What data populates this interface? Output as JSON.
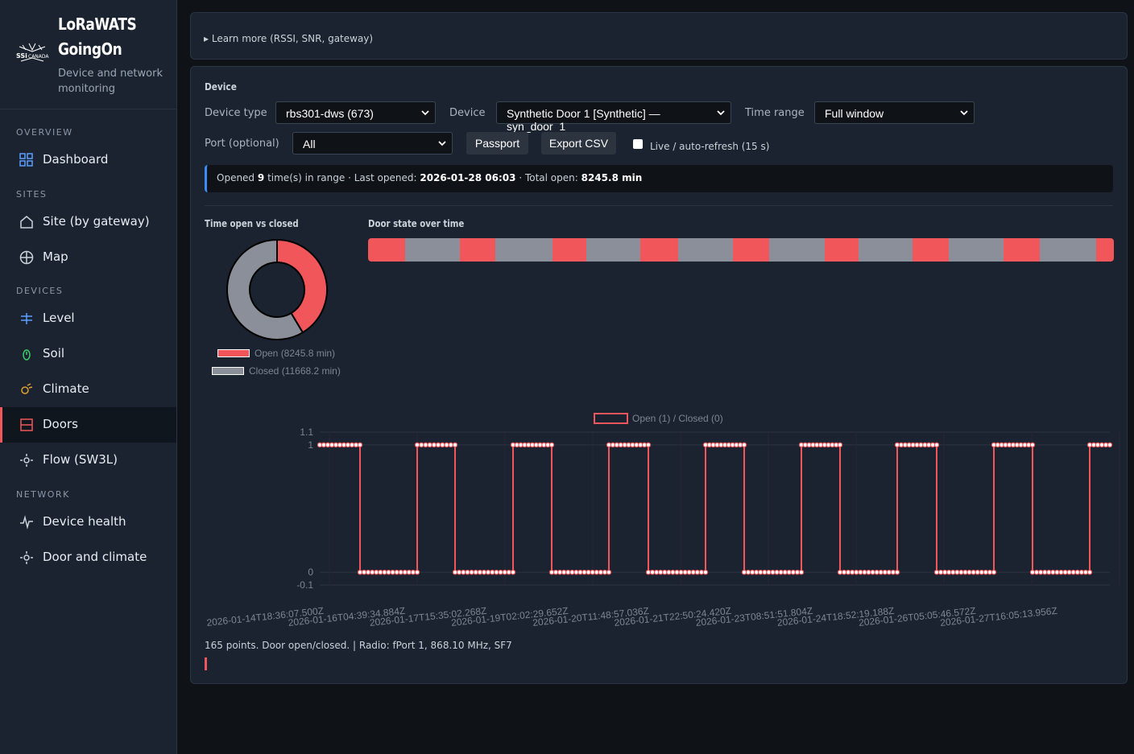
{
  "brand": {
    "title_line1": "LoRaWATS",
    "title_line2": "GoingOn",
    "subtitle": "Device and network monitoring",
    "logo_icon": "ssi-canada-logo"
  },
  "sidebar": {
    "sections": [
      {
        "label": "OVERVIEW"
      },
      {
        "label": "SITES"
      },
      {
        "label": "DEVICES"
      },
      {
        "label": "NETWORK"
      }
    ],
    "items": [
      {
        "label": "Dashboard",
        "icon": "grid-icon"
      },
      {
        "label": "Site (by gateway)",
        "icon": "home-icon"
      },
      {
        "label": "Map",
        "icon": "globe-icon"
      },
      {
        "label": "Level",
        "icon": "level-icon"
      },
      {
        "label": "Soil",
        "icon": "soil-icon"
      },
      {
        "label": "Climate",
        "icon": "climate-icon"
      },
      {
        "label": "Doors",
        "icon": "door-icon",
        "active": true
      },
      {
        "label": "Flow (SW3L)",
        "icon": "flow-icon"
      },
      {
        "label": "Device health",
        "icon": "pulse-icon"
      },
      {
        "label": "Door and climate",
        "icon": "door-climate-icon"
      }
    ]
  },
  "learn_more": "▸ Learn more (RSSI, SNR, gateway)",
  "device_panel": {
    "heading": "Device",
    "device_type_label": "Device type",
    "device_type_value": "rbs301-dws (673)",
    "device_label": "Device",
    "device_value": "Synthetic Door 1 [Synthetic] — syn_door_1",
    "time_range_label": "Time range",
    "time_range_value": "Full window",
    "port_label": "Port (optional)",
    "port_value": "All",
    "passport_button": "Passport",
    "export_button": "Export CSV",
    "live_label": "Live / auto-refresh (15 s)",
    "live_checked": false
  },
  "summary": {
    "prefix": "Opened",
    "count": "9",
    "count_suffix": "time(s) in range · Last opened:",
    "last_opened": "2026-01-28 06:03",
    "total_prefix": "· Total open:",
    "total_open": "8245.8 min"
  },
  "donut": {
    "heading": "Time open vs closed",
    "legend_open": "Open (8245.8 min)",
    "legend_closed": "Closed (11668.2 min)"
  },
  "state_bar": {
    "heading": "Door state over time",
    "segments": [
      {
        "state": "open",
        "start": 0.0,
        "end": 0.05
      },
      {
        "state": "closed",
        "start": 0.05,
        "end": 0.123
      },
      {
        "state": "open",
        "start": 0.123,
        "end": 0.171
      },
      {
        "state": "closed",
        "start": 0.171,
        "end": 0.247
      },
      {
        "state": "open",
        "start": 0.247,
        "end": 0.293
      },
      {
        "state": "closed",
        "start": 0.293,
        "end": 0.365
      },
      {
        "state": "open",
        "start": 0.365,
        "end": 0.416
      },
      {
        "state": "closed",
        "start": 0.416,
        "end": 0.489
      },
      {
        "state": "open",
        "start": 0.489,
        "end": 0.538
      },
      {
        "state": "closed",
        "start": 0.538,
        "end": 0.612
      },
      {
        "state": "open",
        "start": 0.612,
        "end": 0.658
      },
      {
        "state": "closed",
        "start": 0.658,
        "end": 0.73
      },
      {
        "state": "open",
        "start": 0.73,
        "end": 0.779
      },
      {
        "state": "closed",
        "start": 0.779,
        "end": 0.852
      },
      {
        "state": "open",
        "start": 0.852,
        "end": 0.901
      },
      {
        "state": "closed",
        "start": 0.901,
        "end": 0.976
      },
      {
        "state": "open",
        "start": 0.976,
        "end": 1.0
      }
    ]
  },
  "colors": {
    "open": "#f0565a",
    "closed": "#8a8f99",
    "accent": "#3c8cf4"
  },
  "chart_data": [
    {
      "type": "pie",
      "title": "Time open vs closed",
      "labels": [
        "Open (8245.8 min)",
        "Closed (11668.2 min)"
      ],
      "values": [
        8245.8,
        11668.2
      ],
      "colors": [
        "#f0565a",
        "#8a8f99"
      ],
      "legend": "bottom"
    },
    {
      "type": "line",
      "title": "",
      "legend_label": "Open (1) / Closed (0)",
      "legend": "top",
      "ylim": [
        -0.1,
        1.1
      ],
      "yticks": [
        "1.1",
        "1",
        "0",
        "-0.1"
      ],
      "xtick_labels": [
        "2026-01-14T18:36:07.500Z",
        "2026-01-16T04:39:34.884Z",
        "2026-01-17T15:35:02.268Z",
        "2026-01-19T02:02:29.652Z",
        "2026-01-20T11:48:57.036Z",
        "2026-01-21T22:50:24.420Z",
        "2026-01-23T08:51:51.804Z",
        "2026-01-24T18:52:19.188Z",
        "2026-01-26T05:05:46.572Z",
        "2026-01-27T16:05:13.956Z"
      ],
      "step_points": [
        {
          "x": 0,
          "y": 1
        },
        {
          "x": 50,
          "y": 1
        },
        {
          "x": 50,
          "y": 0
        },
        {
          "x": 121,
          "y": 0
        },
        {
          "x": 121,
          "y": 1
        },
        {
          "x": 168,
          "y": 1
        },
        {
          "x": 168,
          "y": 0
        },
        {
          "x": 240,
          "y": 0
        },
        {
          "x": 240,
          "y": 1
        },
        {
          "x": 288,
          "y": 1
        },
        {
          "x": 288,
          "y": 0
        },
        {
          "x": 359,
          "y": 0
        },
        {
          "x": 359,
          "y": 1
        },
        {
          "x": 408,
          "y": 1
        },
        {
          "x": 408,
          "y": 0
        },
        {
          "x": 479,
          "y": 0
        },
        {
          "x": 479,
          "y": 1
        },
        {
          "x": 527,
          "y": 1
        },
        {
          "x": 527,
          "y": 0
        },
        {
          "x": 598,
          "y": 0
        },
        {
          "x": 598,
          "y": 1
        },
        {
          "x": 646,
          "y": 1
        },
        {
          "x": 646,
          "y": 0
        },
        {
          "x": 717,
          "y": 0
        },
        {
          "x": 717,
          "y": 1
        },
        {
          "x": 766,
          "y": 1
        },
        {
          "x": 766,
          "y": 0
        },
        {
          "x": 837,
          "y": 0
        },
        {
          "x": 837,
          "y": 1
        },
        {
          "x": 885,
          "y": 1
        },
        {
          "x": 885,
          "y": 0
        },
        {
          "x": 956,
          "y": 0
        },
        {
          "x": 956,
          "y": 1
        },
        {
          "x": 981,
          "y": 1
        }
      ],
      "points_total": 165,
      "color": "#f0565a",
      "grid": true
    }
  ],
  "footer": "165 points. Door open/closed.  |  Radio: fPort 1, 868.10 MHz, SF7"
}
